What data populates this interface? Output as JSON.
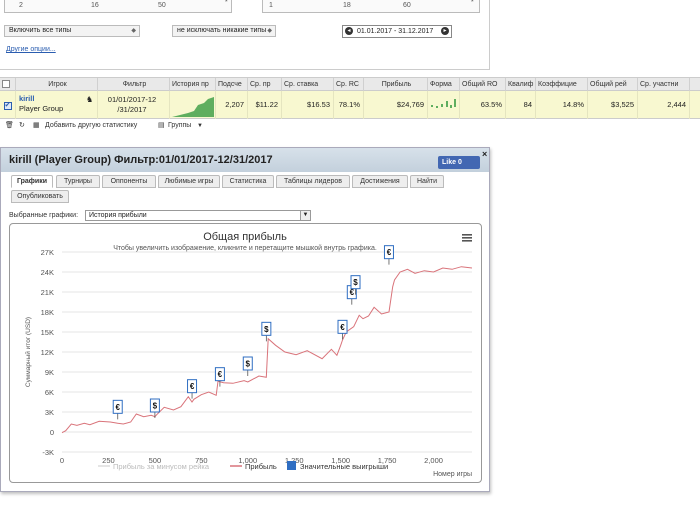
{
  "filters": {
    "slider_left_ticks": [
      "2",
      "16",
      "50"
    ],
    "slider_left_marker": "*",
    "slider_right_ticks": [
      "1",
      "18",
      "60"
    ],
    "slider_right_marker": "*",
    "include_types": "Включить все типы",
    "exclude_types": "не исключать никакие типы",
    "date_range": "01.01.2017 - 31.12.2017",
    "more_options": "Другие опции..."
  },
  "table": {
    "headers": [
      "Игрок",
      "Фильтр",
      "История пр",
      "Подсче",
      "Ср. пр",
      "Ср. ставка",
      "Ср. RC",
      "Прибыль",
      "Форма",
      "Общий RO",
      "Квалиф",
      "Коэффицие",
      "Общий рей",
      "Ср. участни"
    ],
    "row": {
      "player_name": "kirill",
      "player_group": "Player Group",
      "filter_line1": "01/01/2017-12",
      "filter_line2": "/31/2017",
      "count": "2,207",
      "avg_profit": "$11.22",
      "avg_stake": "$16.53",
      "avg_roi": "78.1%",
      "profit": "$24,769",
      "total_roi": "63.5%",
      "qualif": "84",
      "coef": "14.8%",
      "total_rake": "$3,525",
      "avg_entrants": "2,444"
    }
  },
  "toolbar": {
    "add_stat": "Добавить другую статистику",
    "groups": "Группы"
  },
  "dialog": {
    "title": "kirill (Player Group) Фильтр:01/01/2017-12/31/2017",
    "like_label": "Like 0",
    "close": "×",
    "tabs": [
      "Графики",
      "Турниры",
      "Оппоненты",
      "Любимые игры",
      "Статистика",
      "Таблицы лидеров",
      "Достижения",
      "Найти",
      "Опубликовать"
    ],
    "chart_select_label": "Выбранные графики:",
    "chart_select_value": "История прибыли"
  },
  "colors": {
    "profit_line": "#d9737a",
    "rakeback_line": "#dcdcdc",
    "big_wins": "#2f6ec2",
    "accent": "#4267b2"
  },
  "chart_data": {
    "type": "line",
    "title": "Общая прибыль",
    "subtitle": "Чтобы увеличить изображение, кликните и перетащите мышкой внутрь графика.",
    "xlabel": "Номер игры",
    "ylabel": "Суммарный итог (USD)",
    "xlim": [
      0,
      2207
    ],
    "ylim": [
      -3000,
      27000
    ],
    "x_ticks": [
      "0",
      "250",
      "500",
      "750",
      "1,000",
      "1,250",
      "1,500",
      "1,750",
      "2,000"
    ],
    "x_tick_values": [
      0,
      250,
      500,
      750,
      1000,
      1250,
      1500,
      1750,
      2000
    ],
    "y_ticks": [
      "-3K",
      "0",
      "3K",
      "6K",
      "9K",
      "12K",
      "15K",
      "18K",
      "21K",
      "24K",
      "27K"
    ],
    "y_tick_values": [
      -3000,
      0,
      3000,
      6000,
      9000,
      12000,
      15000,
      18000,
      21000,
      24000,
      27000
    ],
    "legend": [
      "Прибыль за минусом рейка",
      "Прибыль",
      "Значительные выигрыши"
    ],
    "series": [
      {
        "name": "Прибыль",
        "x": [
          0,
          20,
          50,
          80,
          120,
          150,
          200,
          260,
          300,
          330,
          370,
          400,
          440,
          480,
          500,
          510,
          550,
          600,
          640,
          680,
          700,
          710,
          750,
          790,
          830,
          840,
          870,
          920,
          980,
          1000,
          1060,
          1100,
          1110,
          1150,
          1200,
          1260,
          1320,
          1400,
          1450,
          1480,
          1500,
          1510,
          1530,
          1570,
          1600,
          1620,
          1650,
          1680,
          1720,
          1760,
          1780,
          1790,
          1820,
          1860,
          1900,
          1950,
          2000,
          2050,
          2100,
          2150,
          2207
        ],
        "y": [
          -100,
          200,
          1200,
          1000,
          1300,
          1100,
          1600,
          1500,
          1300,
          1200,
          1500,
          2700,
          2300,
          2500,
          2300,
          2600,
          3700,
          3300,
          3800,
          5300,
          4500,
          4900,
          5600,
          6000,
          5500,
          7600,
          7400,
          7300,
          7700,
          7500,
          8400,
          8200,
          14000,
          13000,
          12000,
          11600,
          12200,
          11000,
          12400,
          11500,
          13000,
          13800,
          15000,
          15800,
          17500,
          17000,
          17400,
          18700,
          17700,
          18000,
          21800,
          22800,
          24000,
          24400,
          23800,
          24200,
          24000,
          24600,
          24400,
          24800,
          24600
        ]
      }
    ],
    "big_wins": [
      {
        "x": 300,
        "y": 2800,
        "symbol": "€"
      },
      {
        "x": 500,
        "y": 3000,
        "symbol": "$"
      },
      {
        "x": 700,
        "y": 5900,
        "symbol": "€"
      },
      {
        "x": 850,
        "y": 7700,
        "symbol": "€"
      },
      {
        "x": 1000,
        "y": 9300,
        "symbol": "$"
      },
      {
        "x": 1100,
        "y": 14500,
        "symbol": "$"
      },
      {
        "x": 1510,
        "y": 14800,
        "symbol": "€"
      },
      {
        "x": 1560,
        "y": 20000,
        "symbol": "€"
      },
      {
        "x": 1580,
        "y": 21500,
        "symbol": "$"
      },
      {
        "x": 1760,
        "y": 26000,
        "symbol": "€"
      }
    ]
  }
}
